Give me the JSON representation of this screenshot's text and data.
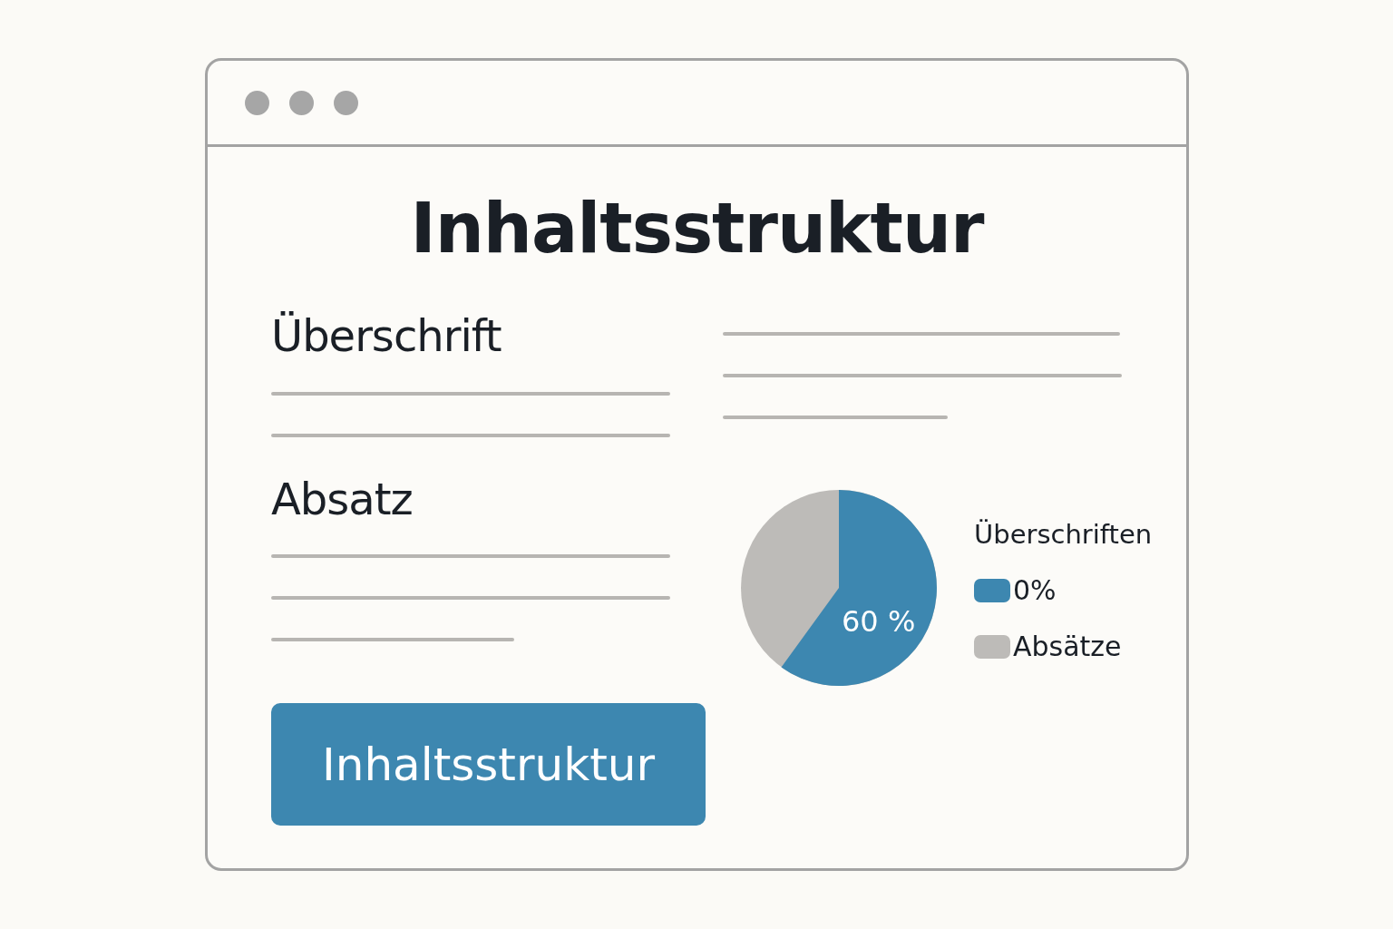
{
  "window": {
    "title": "Inhaltsstruktur"
  },
  "left": {
    "heading": "Überschrift",
    "subheading": "Absatz",
    "button": "Inhaltsstruktur"
  },
  "pie": {
    "label": "60 %",
    "legend_title": "Überschriften",
    "legend": [
      {
        "label": "0%",
        "color": "#3d87b0"
      },
      {
        "label": "Absätze",
        "color": "#bdbbb8"
      }
    ]
  }
}
